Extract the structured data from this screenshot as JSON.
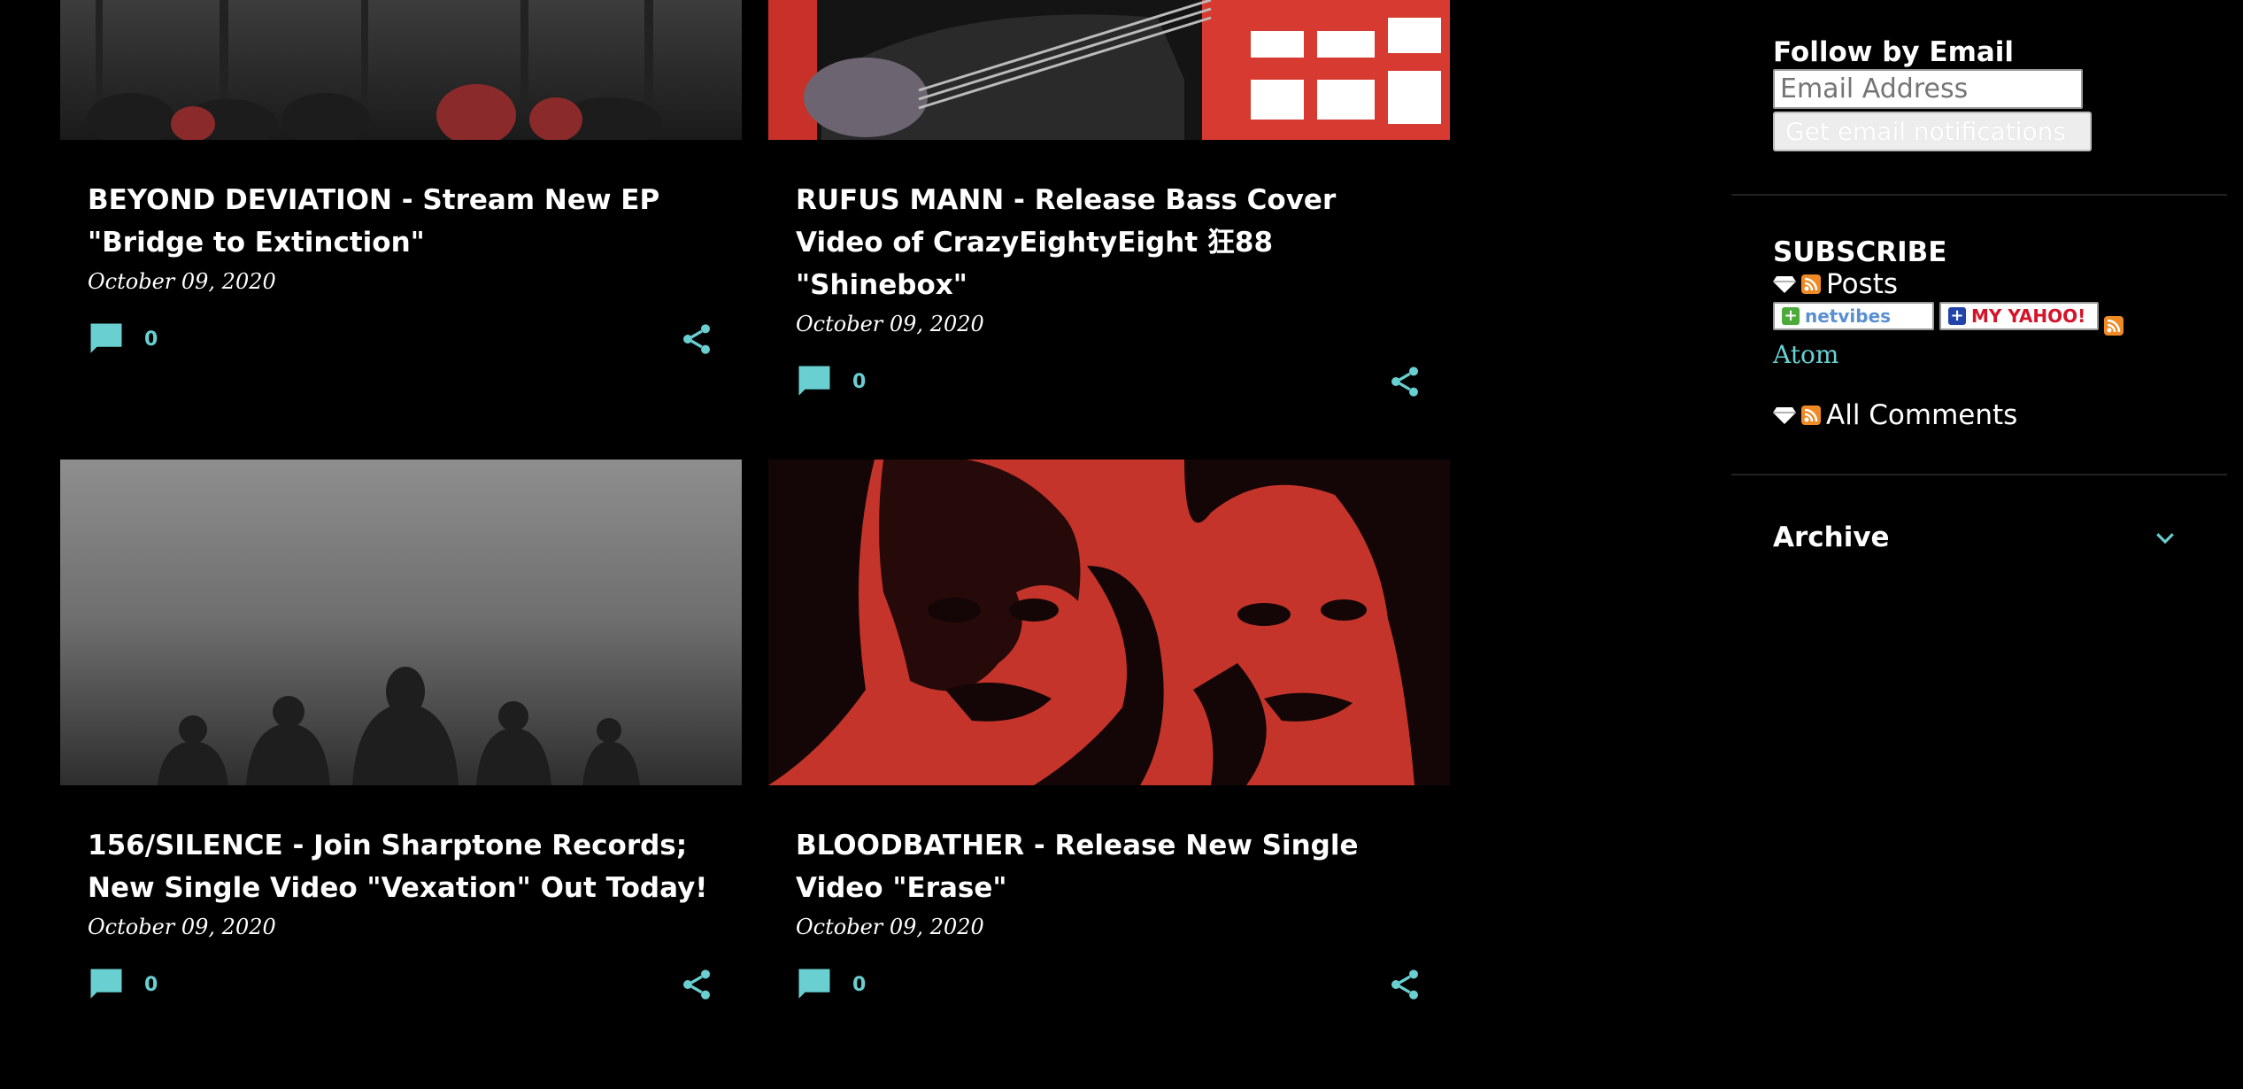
{
  "posts": [
    {
      "title": "BEYOND DEVIATION - Stream New EP \"Bridge to Extinction\"",
      "date": "October 09, 2020",
      "comments": "0"
    },
    {
      "title": "RUFUS MANN - Release Bass Cover Video of CrazyEightyEight 狂88 \"Shinebox\"",
      "date": "October 09, 2020",
      "comments": "0"
    },
    {
      "title": "156/SILENCE - Join Sharptone Records; New Single Video \"Vexation\" Out Today!",
      "date": "October 09, 2020",
      "comments": "0"
    },
    {
      "title": "BLOODBATHER - Release New Single Video \"Erase\"",
      "date": "October 09, 2020",
      "comments": "0"
    }
  ],
  "sidebar": {
    "follow": {
      "title": "Follow by Email",
      "email_placeholder": "Email Address",
      "button_label": "Get email notifications"
    },
    "subscribe": {
      "title": "SUBSCRIBE",
      "posts_label": "Posts",
      "netvibes_label": "netvibes",
      "yahoo_label": "MY YAHOO!",
      "atom_label": "Atom",
      "all_comments_label": "All Comments"
    },
    "archive": {
      "title": "Archive"
    }
  },
  "colors": {
    "accent": "#69cfd1",
    "background": "#000000"
  }
}
